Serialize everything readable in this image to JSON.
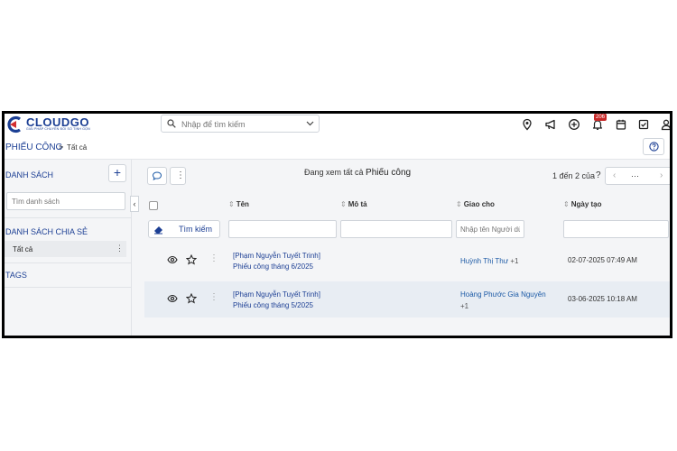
{
  "app": {
    "logo_text": "CLOUDGO",
    "logo_tagline": "GIẢI PHÁP CHUYỂN ĐỔI SỐ TINH GỌN"
  },
  "header": {
    "search_placeholder": "Nhập để tìm kiếm",
    "notification_count": "206",
    "icons": [
      "location-pin-icon",
      "megaphone-icon",
      "add-circle-icon",
      "bell-icon",
      "calendar-icon",
      "checkbox-icon",
      "user-icon"
    ]
  },
  "breadcrumb": {
    "module": "PHIẾU CÔNG",
    "separator": ">",
    "current": "Tất cả"
  },
  "sidebar": {
    "list_title": "DANH SÁCH",
    "search_placeholder": "Tìm danh sách",
    "shared_title": "DANH SÁCH CHIA SẺ",
    "items": [
      {
        "label": "Tất cả"
      }
    ],
    "tags_title": "TAGS"
  },
  "main": {
    "viewing_prefix": "Đang xem tất cả",
    "viewing_module": "Phiếu công",
    "page_info": "1 đến 2 của",
    "page_info_help": "?",
    "pager_more": "···",
    "columns": [
      "Tên",
      "Mô tả",
      "Giao cho",
      "Ngày tạo"
    ],
    "search_button": "Tìm kiếm",
    "assignee_filter_placeholder": "Nhập tên Người dù",
    "rows": [
      {
        "name_line1": "[Phạm Nguyễn Tuyết Trinh]",
        "name_line2": "Phiếu công tháng 6/2025",
        "assignee": "Huỳnh Thị Thư",
        "assignee_more": "+1",
        "created": "02-07-2025 07:49 AM"
      },
      {
        "name_line1": "[Phạm Nguyễn Tuyết Trinh]",
        "name_line2": "Phiếu công tháng 5/2025",
        "assignee": "Hoàng Phước Gia Nguyên",
        "assignee_more": "+1",
        "created": "03-06-2025 10:18 AM"
      }
    ]
  },
  "colors": {
    "brand": "#1c3f94",
    "logo_red": "#d32f2f",
    "link": "#1c5aa6",
    "selected_row": "#e8edf3",
    "badge": "#c62828"
  }
}
